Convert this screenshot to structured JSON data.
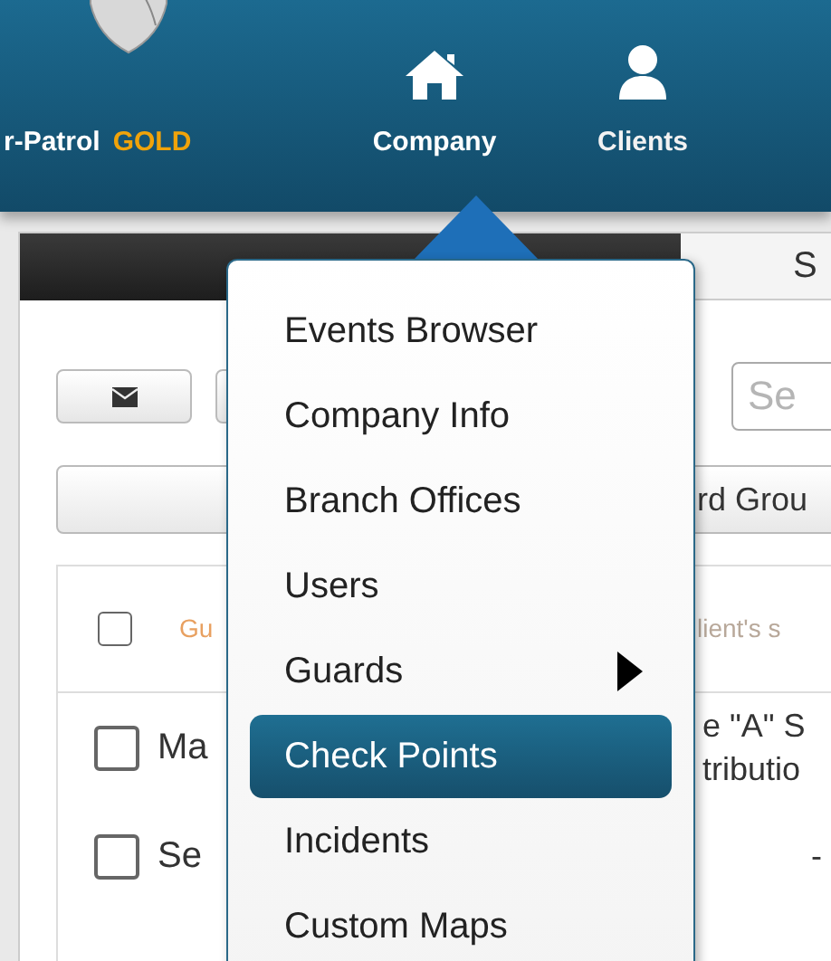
{
  "header": {
    "brand": "r-Patrol",
    "tier": "GOLD",
    "nav": [
      {
        "label": "Company",
        "selected": true
      },
      {
        "label": "Clients",
        "selected": false
      }
    ]
  },
  "panel": {
    "tab_label": "S",
    "search": {
      "placeholder": "Se"
    },
    "group_button": "rd Grou",
    "table": {
      "header": {
        "checked": false,
        "column_1": "Gu",
        "column_2": "lient's s"
      },
      "rows": [
        {
          "checked": false,
          "column_1": "Ma",
          "column_2": [
            "e \"A\" S",
            "tributio"
          ]
        },
        {
          "checked": false,
          "column_1": "Se",
          "column_2": [
            "-"
          ]
        }
      ]
    }
  },
  "menu": {
    "items": [
      {
        "label": "Events Browser",
        "selected": false,
        "submenu": false
      },
      {
        "label": "Company Info",
        "selected": false,
        "submenu": false
      },
      {
        "label": "Branch Offices",
        "selected": false,
        "submenu": false
      },
      {
        "label": "Users",
        "selected": false,
        "submenu": false
      },
      {
        "label": "Guards",
        "selected": false,
        "submenu": true
      },
      {
        "label": "Check Points",
        "selected": true,
        "submenu": false
      },
      {
        "label": "Incidents",
        "selected": false,
        "submenu": false
      },
      {
        "label": "Custom Maps",
        "selected": false,
        "submenu": false
      }
    ]
  }
}
